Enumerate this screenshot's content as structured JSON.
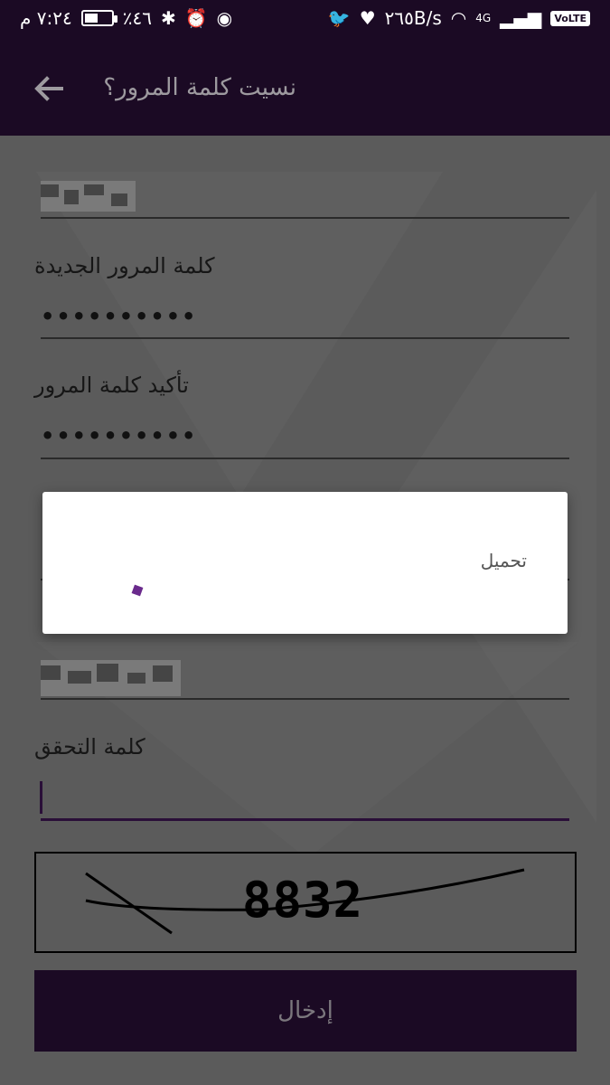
{
  "status_bar": {
    "time": "٧:٢٤ م",
    "battery_percent": "٪٤٦",
    "network_speed": "٢٦٥B/s",
    "signal_type": "4G",
    "volte": "VoLTE"
  },
  "app_bar": {
    "title": "نسيت كلمة المرور؟"
  },
  "form": {
    "new_password_label": "كلمة المرور الجديدة",
    "new_password_value": "••••••••••",
    "confirm_password_label": "تأكيد كلمة المرور",
    "confirm_password_value": "••••••••••",
    "verification_label": "كلمة التحقق",
    "captcha_text": "8832",
    "submit_label": "إدخال"
  },
  "dialog": {
    "loading_text": "تحميل"
  }
}
